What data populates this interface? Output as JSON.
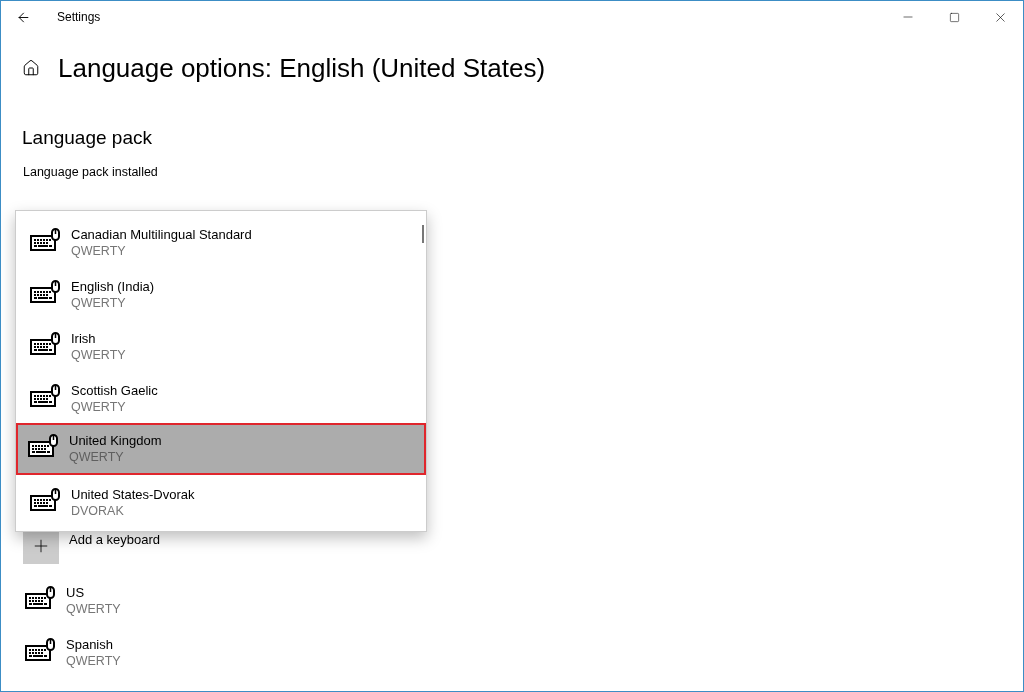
{
  "window": {
    "title": "Settings"
  },
  "page_title": "Language options: English (United States)",
  "language_pack": {
    "heading": "Language pack",
    "status": "Language pack installed"
  },
  "keyboard_picker": {
    "items": [
      {
        "name": "Canadian Multilingual Standard",
        "layout": "QWERTY",
        "selected": false
      },
      {
        "name": "English (India)",
        "layout": "QWERTY",
        "selected": false
      },
      {
        "name": "Irish",
        "layout": "QWERTY",
        "selected": false
      },
      {
        "name": "Scottish Gaelic",
        "layout": "QWERTY",
        "selected": false
      },
      {
        "name": "United Kingdom",
        "layout": "QWERTY",
        "selected": true
      },
      {
        "name": "United States-Dvorak",
        "layout": "DVORAK",
        "selected": false
      }
    ]
  },
  "add_keyboard": {
    "label": "Add a keyboard"
  },
  "keyboards": [
    {
      "name": "US",
      "layout": "QWERTY"
    },
    {
      "name": "Spanish",
      "layout": "QWERTY"
    }
  ]
}
